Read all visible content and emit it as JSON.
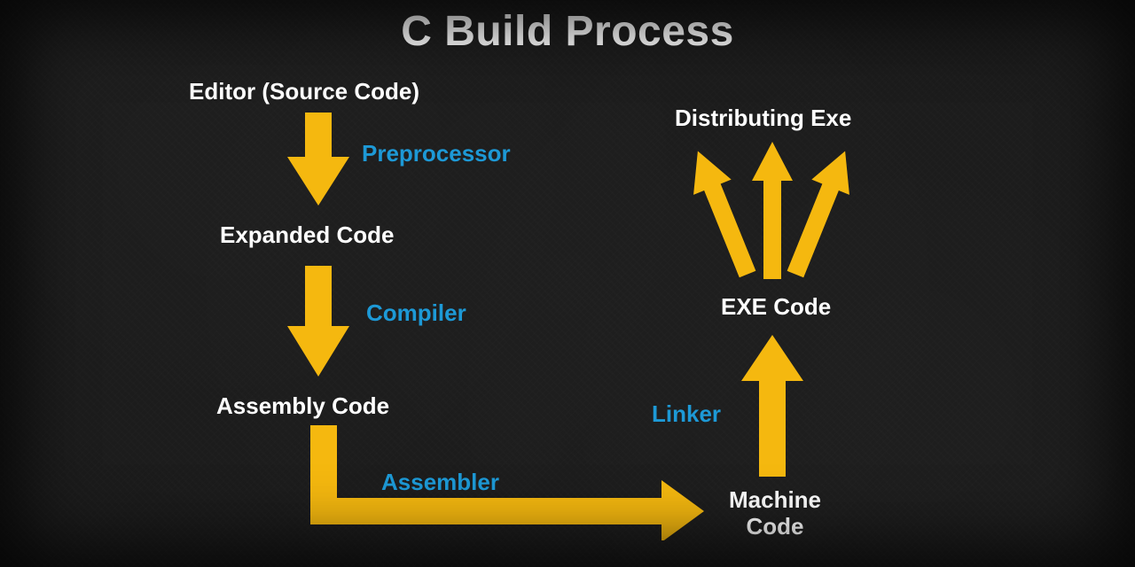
{
  "title": "C Build Process",
  "nodes": {
    "editor": "Editor (Source Code)",
    "expanded": "Expanded Code",
    "assembly": "Assembly Code",
    "machine": "Machine Code",
    "exe": "EXE Code",
    "distributing": "Distributing Exe"
  },
  "processes": {
    "preprocessor": "Preprocessor",
    "compiler": "Compiler",
    "assembler": "Assembler",
    "linker": "Linker"
  },
  "colors": {
    "arrow": "#f5b80f",
    "process": "#1d99d6",
    "text": "#ffffff",
    "background": "#1a1a1a"
  }
}
